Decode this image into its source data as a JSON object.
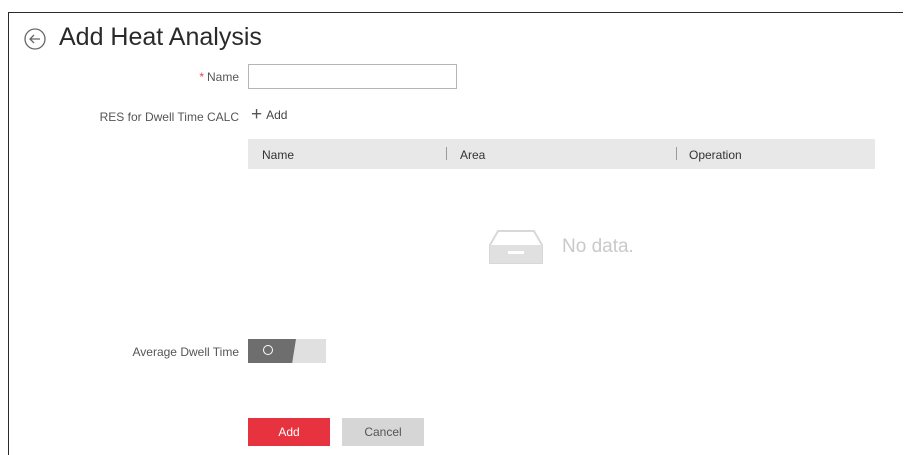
{
  "header": {
    "title": "Add Heat Analysis"
  },
  "form": {
    "name_label": "Name",
    "required_mark": "*",
    "name_value": "",
    "name_placeholder": "",
    "res_label": "RES for Dwell Time CALC",
    "add_link_label": "Add",
    "average_label": "Average Dwell Time",
    "average_enabled": false
  },
  "table": {
    "columns": [
      "Name",
      "Area",
      "Operation"
    ],
    "rows": [],
    "empty_text": "No data."
  },
  "buttons": {
    "add": "Add",
    "cancel": "Cancel"
  },
  "colors": {
    "primary": "#e7323f",
    "toggle_off": "#6e6e6e",
    "header_bg": "#e8e8e8"
  }
}
